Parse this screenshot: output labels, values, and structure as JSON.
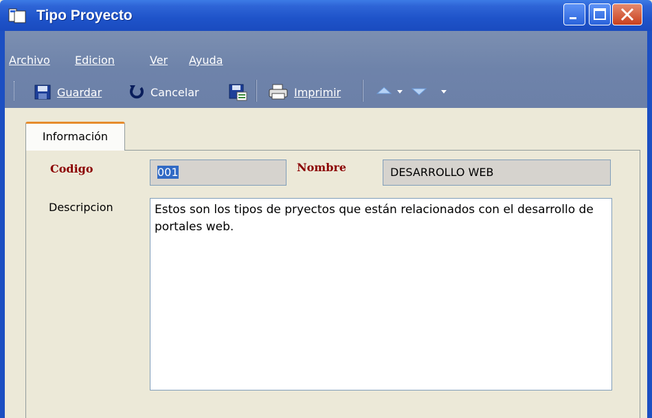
{
  "window": {
    "title": "Tipo Proyecto"
  },
  "menu": {
    "archivo": "Archivo",
    "edicion": "Edicion",
    "ver": "Ver",
    "ayuda": "Ayuda"
  },
  "toolbar": {
    "guardar": "Guardar",
    "cancelar": "Cancelar",
    "imprimir": "Imprimir"
  },
  "tabs": [
    {
      "label": "Información"
    }
  ],
  "form": {
    "codigo_label": "Codigo",
    "codigo_value": "001",
    "nombre_label": "Nombre",
    "nombre_value": "DESARROLLO WEB",
    "descripcion_label": "Descripcion",
    "descripcion_value": "Estos son los tipos de pryectos que están relacionados con el desarrollo de portales web."
  },
  "colors": {
    "titlebar": "#1E53C9",
    "menubar": "#6E83AA",
    "required_label": "#8B0000",
    "tab_accent": "#E68B2C"
  },
  "icons": [
    "window-icon",
    "minimize-icon",
    "maximize-icon",
    "close-icon",
    "save-icon",
    "undo-icon",
    "save-as-icon",
    "print-icon",
    "arrow-up-icon",
    "arrow-down-icon"
  ]
}
